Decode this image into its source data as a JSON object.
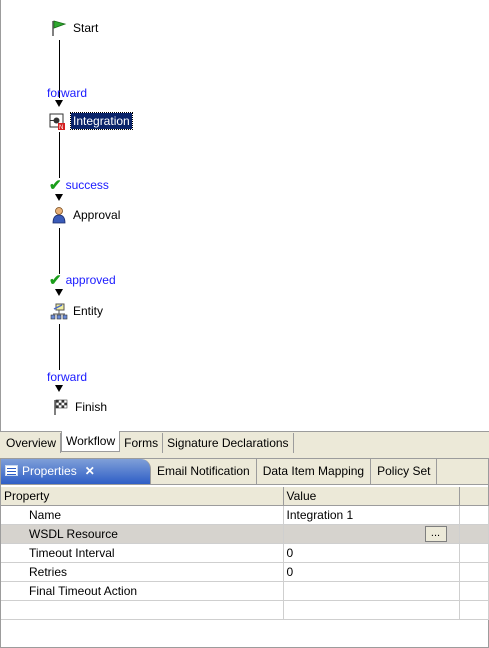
{
  "workflow": {
    "nodes": [
      {
        "label": "Start",
        "icon": "green-flag-icon"
      },
      {
        "label": "Integration",
        "icon": "integration-icon",
        "selected": true
      },
      {
        "label": "Approval",
        "icon": "user-icon"
      },
      {
        "label": "Entity",
        "icon": "entity-icon"
      },
      {
        "label": "Finish",
        "icon": "checkered-flag-icon"
      }
    ],
    "transitions": [
      {
        "label": "forward",
        "check": false
      },
      {
        "label": "success",
        "check": true
      },
      {
        "label": "approved",
        "check": true
      },
      {
        "label": "forward",
        "check": false
      }
    ]
  },
  "editor_tabs": [
    "Overview",
    "Workflow",
    "Forms",
    "Signature Declarations"
  ],
  "editor_tabs_active": "Workflow",
  "properties_view": {
    "tabs": [
      "Properties",
      "Email Notification",
      "Data Item Mapping",
      "Policy Set"
    ],
    "active_tab": "Properties",
    "close_glyph": "✕",
    "columns": [
      "Property",
      "Value"
    ],
    "rows": [
      {
        "name": "Name",
        "value": "Integration 1"
      },
      {
        "name": "WSDL Resource",
        "value": "",
        "button": "..."
      },
      {
        "name": "Timeout Interval",
        "value": "0"
      },
      {
        "name": "Retries",
        "value": "0"
      },
      {
        "name": "Final Timeout Action",
        "value": ""
      }
    ]
  },
  "colors": {
    "selection": "#0a246a",
    "transition_text": "#1a1aff",
    "check": "#1a9e1a",
    "active_tab": "#2e5ec6"
  }
}
